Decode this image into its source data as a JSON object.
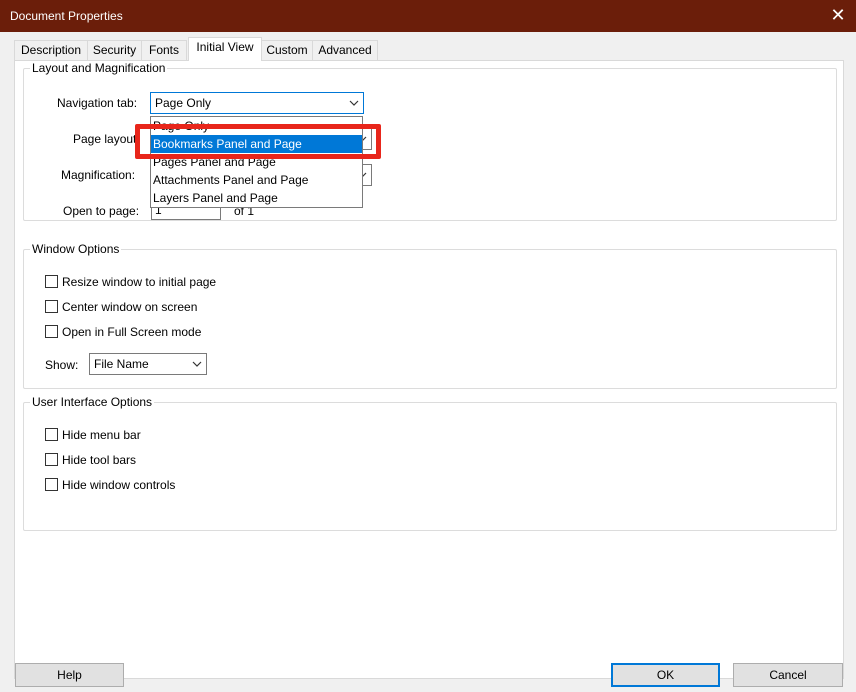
{
  "window": {
    "title": "Document Properties",
    "close_glyph": "✕"
  },
  "tabs": [
    {
      "label": "Description"
    },
    {
      "label": "Security"
    },
    {
      "label": "Fonts"
    },
    {
      "label": "Initial View"
    },
    {
      "label": "Custom"
    },
    {
      "label": "Advanced"
    }
  ],
  "active_tab": "Initial View",
  "layout_group": {
    "legend": "Layout and Magnification",
    "navigation_tab_label": "Navigation tab:",
    "navigation_tab_value": "Page Only",
    "page_layout_label": "Page layout",
    "magnification_label": "Magnification:",
    "open_to_page_label": "Open to page:",
    "open_to_page_value": "1",
    "of_pages": "of 1"
  },
  "navigation_dropdown": {
    "options": [
      "Page Only",
      "Bookmarks Panel and Page",
      "Pages Panel and Page",
      "Attachments Panel and Page",
      "Layers Panel and Page"
    ],
    "highlighted_option": "Bookmarks Panel and Page"
  },
  "window_group": {
    "legend": "Window Options",
    "checkboxes": [
      {
        "label": "Resize window to initial page",
        "checked": false
      },
      {
        "label": "Center window on screen",
        "checked": false
      },
      {
        "label": "Open in Full Screen mode",
        "checked": false
      }
    ],
    "show_label": "Show:",
    "show_value": "File Name"
  },
  "ui_group": {
    "legend": "User Interface Options",
    "checkboxes": [
      {
        "label": "Hide menu bar",
        "checked": false
      },
      {
        "label": "Hide tool bars",
        "checked": false
      },
      {
        "label": "Hide window controls",
        "checked": false
      }
    ]
  },
  "buttons": {
    "help": "Help",
    "ok": "OK",
    "cancel": "Cancel"
  },
  "colors": {
    "titlebar": "#6b1e0a",
    "accent": "#0078d7",
    "annotation": "#e8261b"
  }
}
